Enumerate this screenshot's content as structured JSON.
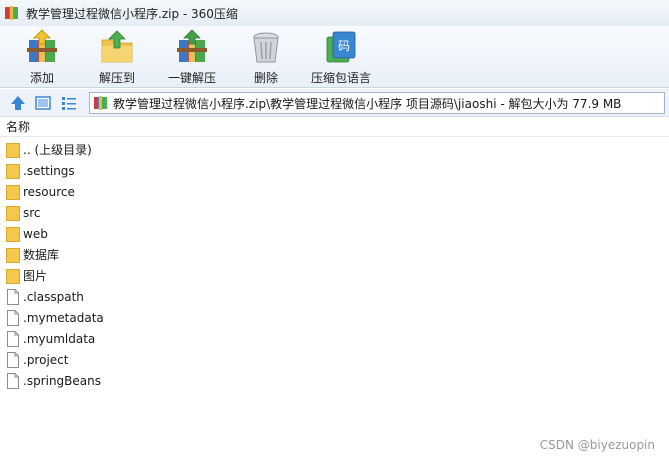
{
  "window": {
    "title": "教学管理过程微信小程序.zip - 360压缩"
  },
  "toolbar": {
    "add_label": "添加",
    "extract_label": "解压到",
    "oneclick_label": "一键解压",
    "delete_label": "删除",
    "comment_label": "压缩包语言"
  },
  "path": {
    "text": "教学管理过程微信小程序.zip\\教学管理过程微信小程序 项目源码\\jiaoshi - 解包大小为 77.9 MB"
  },
  "list": {
    "column_name": "名称",
    "items": [
      {
        "name": ".. (上级目录)",
        "type": "folder"
      },
      {
        "name": ".settings",
        "type": "folder"
      },
      {
        "name": "resource",
        "type": "folder"
      },
      {
        "name": "src",
        "type": "folder"
      },
      {
        "name": "web",
        "type": "folder"
      },
      {
        "name": "数据库",
        "type": "folder"
      },
      {
        "name": "图片",
        "type": "folder"
      },
      {
        "name": ".classpath",
        "type": "file"
      },
      {
        "name": ".mymetadata",
        "type": "file"
      },
      {
        "name": ".myumldata",
        "type": "file"
      },
      {
        "name": ".project",
        "type": "file"
      },
      {
        "name": ".springBeans",
        "type": "file"
      }
    ]
  },
  "watermark": "CSDN @biyezuopin",
  "colors": {
    "folder": "#f5c84c",
    "accent": "#2b7bd6"
  }
}
